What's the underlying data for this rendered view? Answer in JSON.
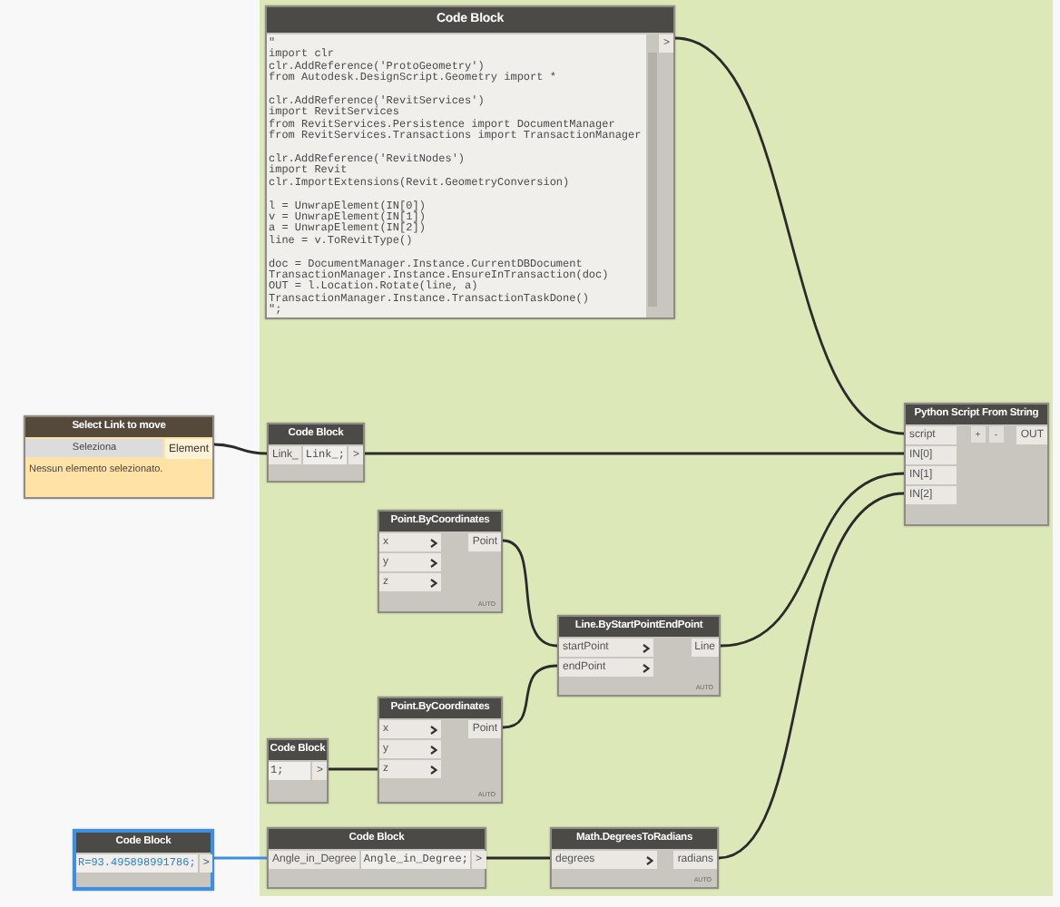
{
  "nodes": [
    {
      "kind": "code",
      "title": "Code Block",
      "selected": false,
      "code": [
        [
          "\"",
          "import clr",
          "clr.AddReference('ProtoGeometry')",
          "from Autodesk.DesignScript.Geometry import *"
        ],
        [
          "clr.AddReference('RevitServices')",
          "import RevitServices",
          "from RevitServices.Persistence import DocumentManager",
          "from RevitServices.Transactions import TransactionManager"
        ],
        [
          "clr.AddReference('RevitNodes')",
          "import Revit",
          "clr.ImportExtensions(Revit.GeometryConversion)"
        ],
        [
          "l = UnwrapElement(IN[0])",
          "v = UnwrapElement(IN[1])",
          "a = UnwrapElement(IN[2])",
          "line = v.ToRevitType()"
        ],
        [
          "doc = DocumentManager.Instance.CurrentDBDocument",
          "TransactionManager.Instance.EnsureInTransaction(doc)",
          "OUT = l.Location.Rotate(line, a)",
          "TransactionManager.Instance.TransactionTaskDone()",
          "\";"
        ]
      ],
      "outputs": [
        ">"
      ]
    },
    {
      "kind": "select",
      "title": "Select Link to move",
      "selected": false,
      "button": "Seleziona",
      "outputs": [
        "Element"
      ],
      "message": "Nessun elemento selezionato."
    },
    {
      "kind": "code",
      "title": "Code Block",
      "selected": false,
      "inputs": [
        "Link_"
      ],
      "code": [
        [
          "Link_;"
        ]
      ],
      "outputs": [
        ">"
      ]
    },
    {
      "kind": "node",
      "title": "Python Script From String",
      "selected": false,
      "input_arrows": false,
      "inputs": [
        "script",
        "IN[0]",
        "IN[1]",
        "IN[2]"
      ],
      "buttons": [
        "+",
        "-"
      ],
      "outputs": [
        "OUT"
      ]
    },
    {
      "kind": "node",
      "title": "Point.ByCoordinates",
      "selected": false,
      "input_arrows": true,
      "inputs": [
        "x",
        "y",
        "z"
      ],
      "outputs": [
        "Point"
      ],
      "lacing": "AUTO"
    },
    {
      "kind": "node",
      "title": "Line.ByStartPointEndPoint",
      "selected": false,
      "input_arrows": true,
      "inputs": [
        "startPoint",
        "endPoint"
      ],
      "outputs": [
        "Line"
      ],
      "lacing": "AUTO"
    },
    {
      "kind": "node",
      "title": "Point.ByCoordinates",
      "selected": false,
      "input_arrows": true,
      "inputs": [
        "x",
        "y",
        "z"
      ],
      "outputs": [
        "Point"
      ],
      "lacing": "AUTO"
    },
    {
      "kind": "code",
      "title": "Code Block",
      "selected": false,
      "code": [
        [
          "1;"
        ]
      ],
      "outputs": [
        ">"
      ]
    },
    {
      "kind": "code",
      "title": "Code Block",
      "selected": true,
      "code": [
        [
          "R=93.495898991786;"
        ]
      ],
      "outputs": [
        ">"
      ]
    },
    {
      "kind": "code",
      "title": "Code Block",
      "selected": false,
      "inputs": [
        "Angle_in_Degree"
      ],
      "code": [
        [
          "Angle_in_Degree;"
        ]
      ],
      "outputs": [
        ">"
      ]
    },
    {
      "kind": "node",
      "title": "Math.DegreesToRadians",
      "selected": false,
      "input_arrows": true,
      "inputs": [
        "degrees"
      ],
      "outputs": [
        "radians"
      ],
      "lacing": "AUTO"
    }
  ]
}
